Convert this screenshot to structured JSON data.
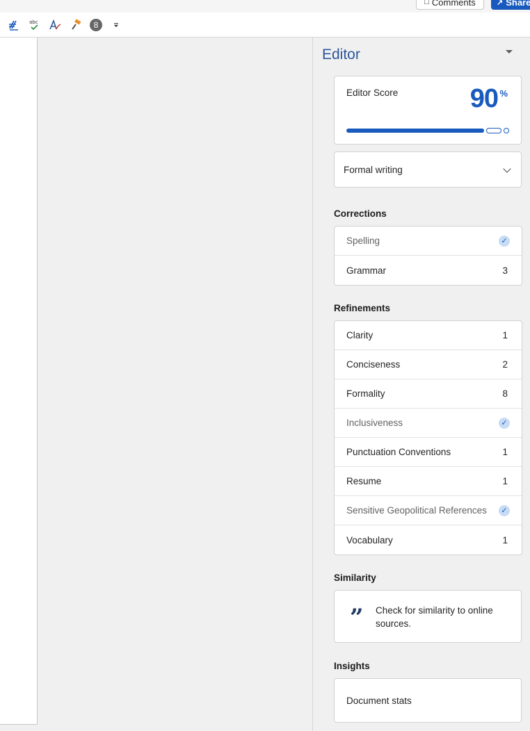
{
  "header": {
    "comments_label": "Comments",
    "share_label": "Share"
  },
  "toolbar": {
    "icons": [
      "editor-icon",
      "spelling-icon",
      "font-style-icon",
      "format-painter-icon",
      "number-badge-icon",
      "more-options-icon"
    ],
    "badge_value": "8"
  },
  "editor": {
    "title": "Editor",
    "score_label": "Editor Score",
    "score_value": "90",
    "score_unit": "%",
    "score_progress": 0.9,
    "writing_style": "Formal writing",
    "accent_color": "#185abd"
  },
  "corrections": {
    "heading": "Corrections",
    "items": [
      {
        "label": "Spelling",
        "value": "",
        "done": true
      },
      {
        "label": "Grammar",
        "value": "3",
        "done": false
      }
    ]
  },
  "refinements": {
    "heading": "Refinements",
    "items": [
      {
        "label": "Clarity",
        "value": "1",
        "done": false
      },
      {
        "label": "Conciseness",
        "value": "2",
        "done": false
      },
      {
        "label": "Formality",
        "value": "8",
        "done": false
      },
      {
        "label": "Inclusiveness",
        "value": "",
        "done": true
      },
      {
        "label": "Punctuation Conventions",
        "value": "1",
        "done": false
      },
      {
        "label": "Resume",
        "value": "1",
        "done": false
      },
      {
        "label": "Sensitive Geopolitical References",
        "value": "",
        "done": true
      },
      {
        "label": "Vocabulary",
        "value": "1",
        "done": false
      }
    ]
  },
  "similarity": {
    "heading": "Similarity",
    "text": "Check for similarity to online sources."
  },
  "insights": {
    "heading": "Insights",
    "item": "Document stats"
  }
}
